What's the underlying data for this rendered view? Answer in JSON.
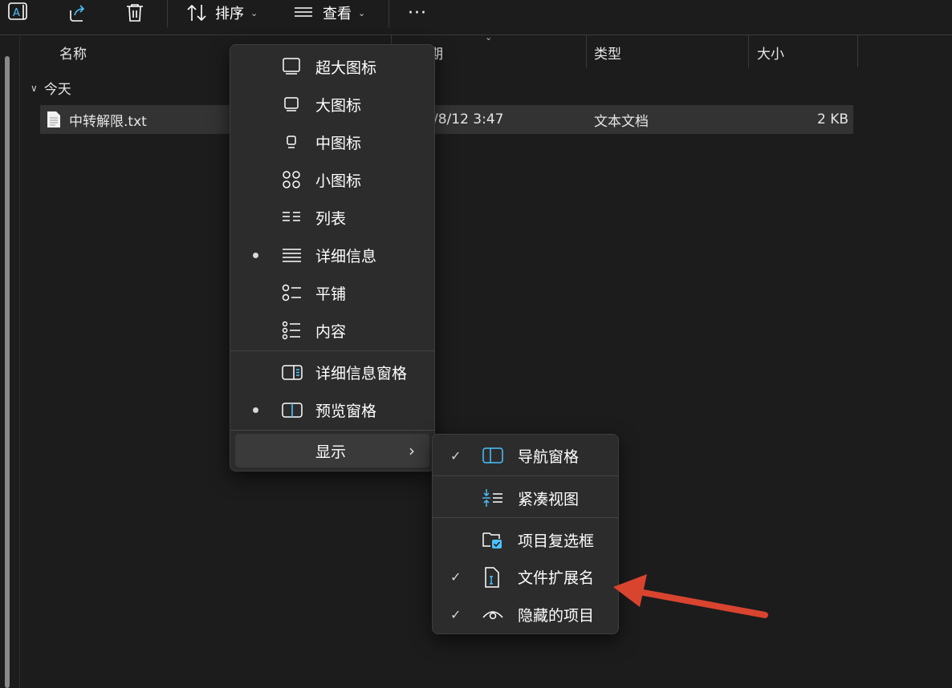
{
  "toolbar": {
    "sort_label": "排序",
    "view_label": "查看",
    "more_label": "···",
    "icons": [
      "rename-icon",
      "share-icon",
      "delete-icon",
      "sort-icon",
      "view-icon",
      "more-icon"
    ]
  },
  "columns": {
    "name": "名称",
    "date": "日期",
    "type": "类型",
    "size": "大小"
  },
  "group": {
    "label": "今天"
  },
  "files": [
    {
      "name": "中转解限.txt",
      "date": "/8/12 3:47",
      "type": "文本文档",
      "size": "2 KB"
    }
  ],
  "view_menu": {
    "items": [
      {
        "label": "超大图标",
        "icon": "extra-large-icons-icon",
        "selected": false
      },
      {
        "label": "大图标",
        "icon": "large-icons-icon",
        "selected": false
      },
      {
        "label": "中图标",
        "icon": "medium-icons-icon",
        "selected": false
      },
      {
        "label": "小图标",
        "icon": "small-icons-icon",
        "selected": false
      },
      {
        "label": "列表",
        "icon": "list-icon",
        "selected": false
      },
      {
        "label": "详细信息",
        "icon": "details-icon",
        "selected": true
      },
      {
        "label": "平铺",
        "icon": "tiles-icon",
        "selected": false
      },
      {
        "label": "内容",
        "icon": "content-icon",
        "selected": false
      }
    ],
    "panes": [
      {
        "label": "详细信息窗格",
        "icon": "details-pane-icon",
        "selected": false
      },
      {
        "label": "预览窗格",
        "icon": "preview-pane-icon",
        "selected": true
      }
    ],
    "show_label": "显示",
    "show_chevron": "›"
  },
  "show_submenu": {
    "items": [
      {
        "label": "导航窗格",
        "icon": "navigation-pane-icon",
        "checked": true
      },
      {
        "label": "紧凑视图",
        "icon": "compact-view-icon",
        "checked": false
      },
      {
        "label": "项目复选框",
        "icon": "item-checkbox-icon",
        "checked": false
      },
      {
        "label": "文件扩展名",
        "icon": "file-extension-icon",
        "checked": true
      },
      {
        "label": "隐藏的项目",
        "icon": "hidden-items-icon",
        "checked": true
      }
    ],
    "check_glyph": "✓"
  },
  "colors": {
    "accent": "#4cc2ff",
    "annotation_arrow": "#d9442f",
    "background": "#1c1c1c",
    "menu_bg": "#2c2c2c"
  }
}
